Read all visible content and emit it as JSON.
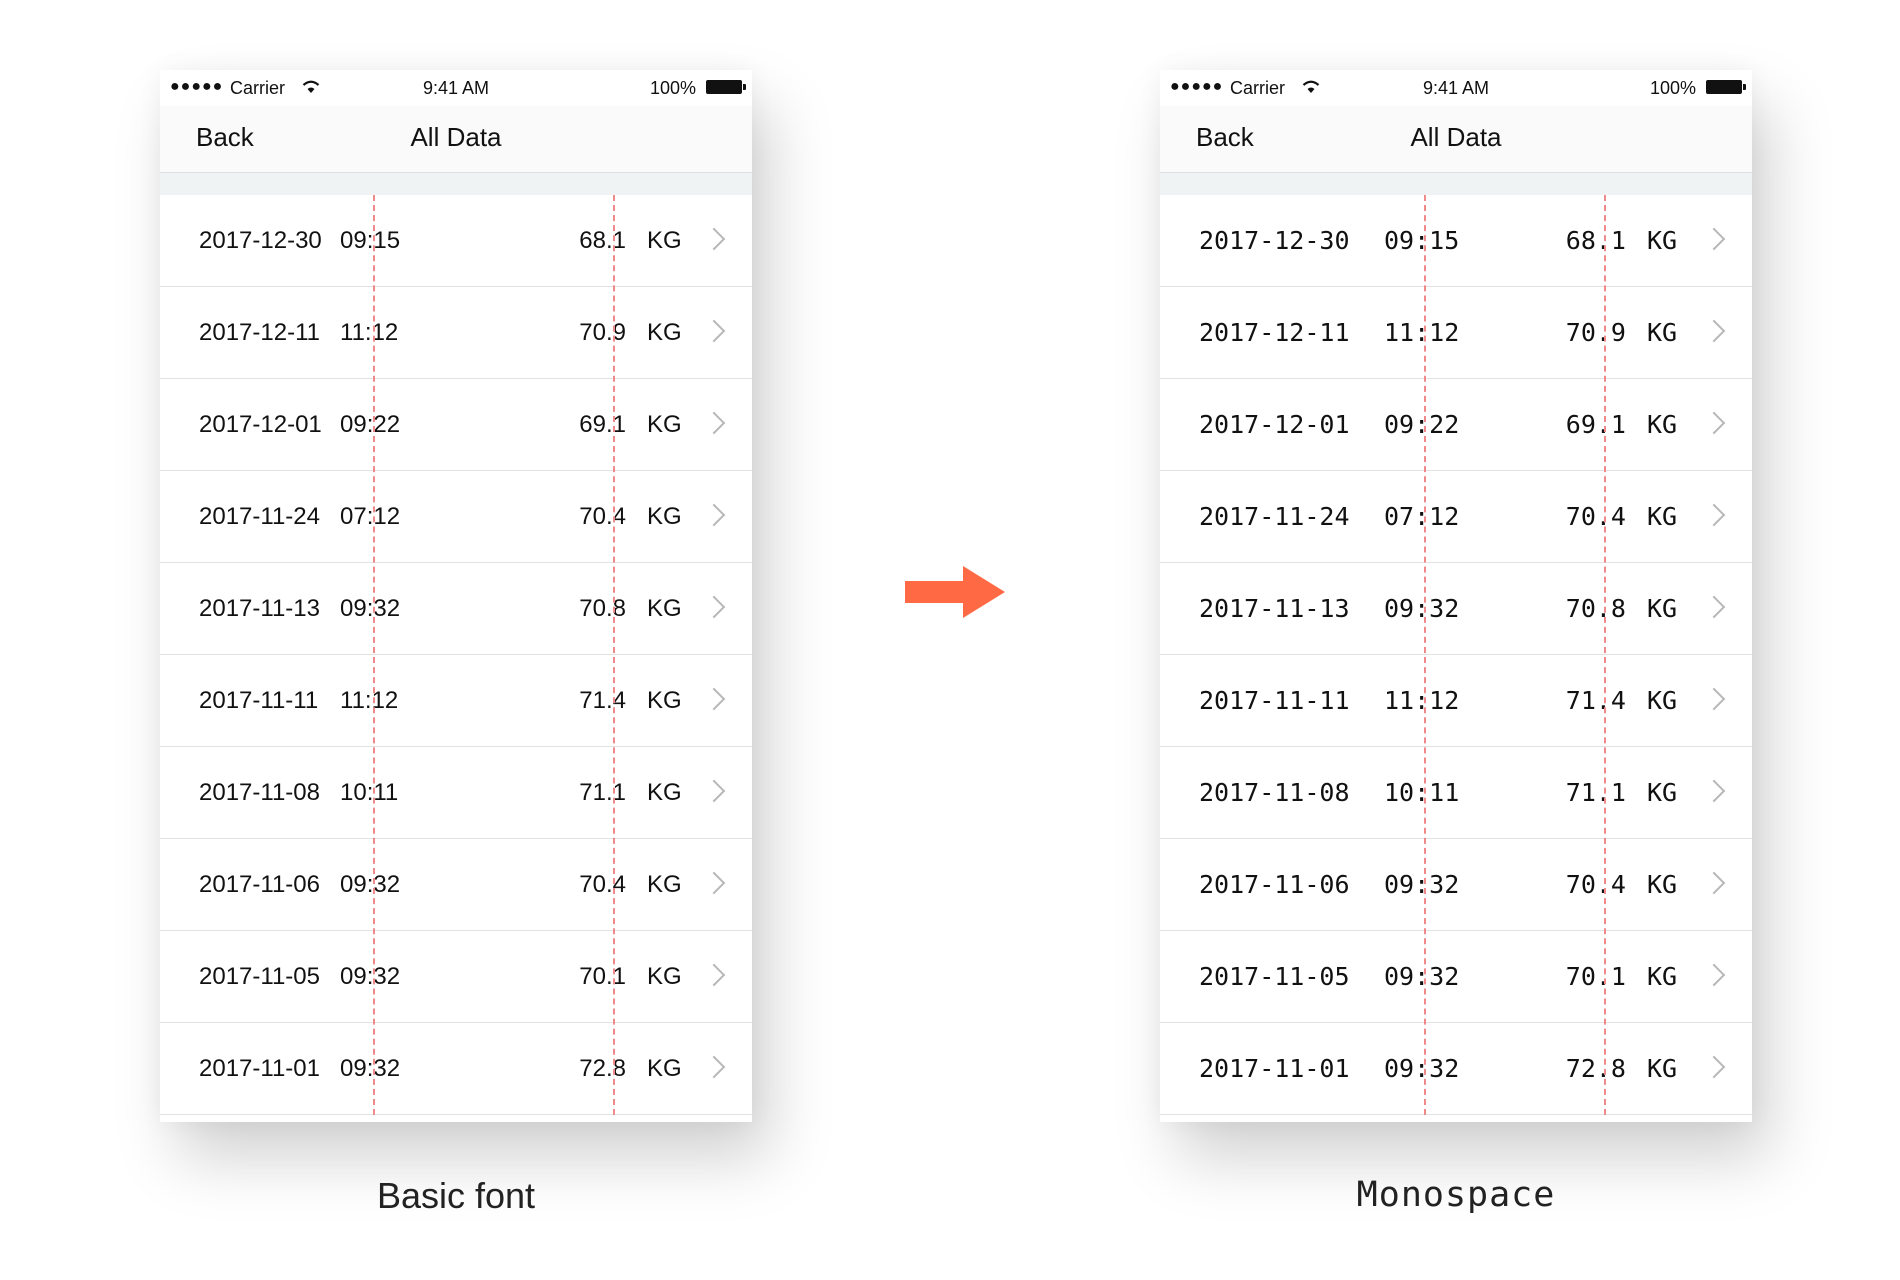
{
  "status_bar": {
    "signal": "●●●●●",
    "carrier": "Carrier",
    "time": "9:41 AM",
    "battery": "100%"
  },
  "nav": {
    "back_label": "Back",
    "title": "All Data"
  },
  "rows": [
    {
      "date": "2017-12-30",
      "time": "09:15",
      "value": "68.1",
      "unit": "KG"
    },
    {
      "date": "2017-12-11",
      "time": "11:12",
      "value": "70.9",
      "unit": "KG"
    },
    {
      "date": "2017-12-01",
      "time": "09:22",
      "value": "69.1",
      "unit": "KG"
    },
    {
      "date": "2017-11-24",
      "time": "07:12",
      "value": "70.4",
      "unit": "KG"
    },
    {
      "date": "2017-11-13",
      "time": "09:32",
      "value": "70.8",
      "unit": "KG"
    },
    {
      "date": "2017-11-11",
      "time": "11:12",
      "value": "71.4",
      "unit": "KG"
    },
    {
      "date": "2017-11-08",
      "time": "10:11",
      "value": "71.1",
      "unit": "KG"
    },
    {
      "date": "2017-11-06",
      "time": "09:32",
      "value": "70.4",
      "unit": "KG"
    },
    {
      "date": "2017-11-05",
      "time": "09:32",
      "value": "70.1",
      "unit": "KG"
    },
    {
      "date": "2017-11-01",
      "time": "09:32",
      "value": "72.8",
      "unit": "KG"
    }
  ],
  "captions": {
    "left": "Basic font",
    "right": "Monospace"
  },
  "colors": {
    "arrow": "#ff6a45",
    "guide_line": "#f08a8a",
    "section_gap": "#eff3f3"
  },
  "icons": {
    "arrow": "arrow-right-icon",
    "chevron": "chevron-right-icon",
    "wifi": "wifi-icon",
    "battery": "battery-icon"
  }
}
